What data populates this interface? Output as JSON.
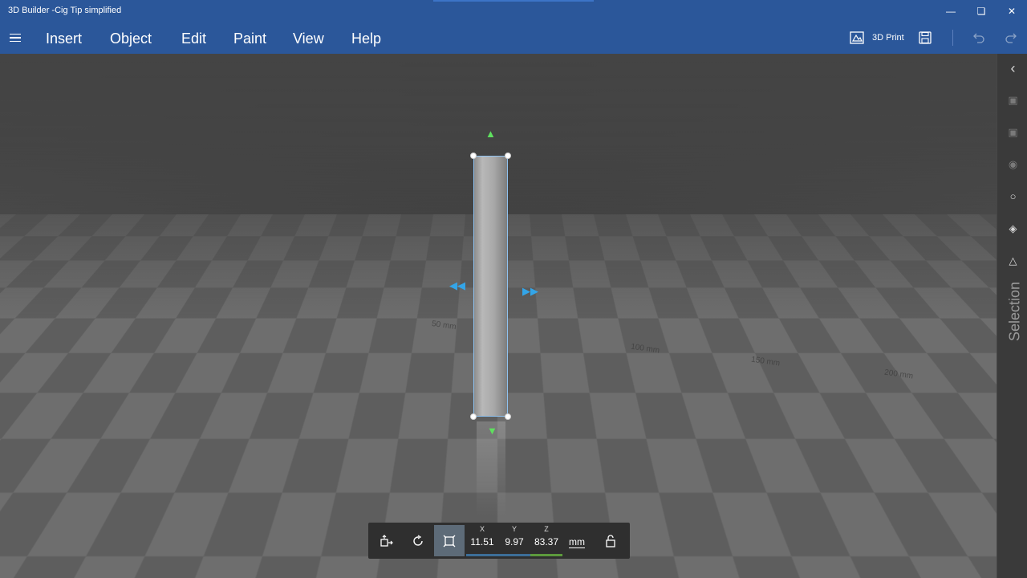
{
  "window": {
    "title": "3D Builder -Cig Tip simplified",
    "controls": [
      "minimize-icon",
      "maximize-icon",
      "close-icon"
    ]
  },
  "menu": {
    "items": [
      "Insert",
      "Object",
      "Edit",
      "Paint",
      "View",
      "Help"
    ]
  },
  "toolbar": {
    "print_label": "3D Print",
    "icons": [
      "3d-print-icon",
      "save-icon",
      "undo-icon",
      "redo-icon"
    ]
  },
  "viewport": {
    "ruler_labels": [
      "50 mm",
      "100 mm",
      "150 mm",
      "200 mm"
    ],
    "selected_object": "Cig Tip simplified"
  },
  "sidebar": {
    "label": "Selection",
    "icons": [
      "collapse-chevron-icon",
      "select-objects-icon",
      "select-faces-icon",
      "select-edges-icon",
      "select-vertices-icon",
      "select-mesh-icon",
      "select-triangle-icon"
    ]
  },
  "bottom_toolbar": {
    "icons": [
      "move-icon",
      "rotate-icon",
      "scale-icon",
      "lock-icon"
    ],
    "x_label": "X",
    "x_value": "11.51",
    "y_label": "Y",
    "y_value": "9.97",
    "z_label": "Z",
    "z_value": "83.37",
    "unit": "mm"
  },
  "colors": {
    "accent": "#2b579a",
    "x_axis": "#3c6e98",
    "y_axis": "#3c6e98",
    "z_axis": "#5c9a3c",
    "selection_outline": "#8fc2f0"
  }
}
